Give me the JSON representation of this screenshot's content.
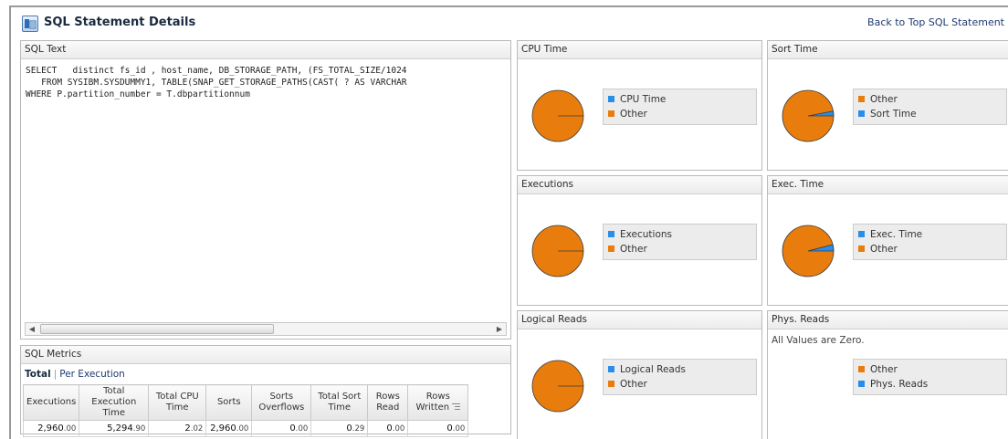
{
  "page": {
    "title": "SQL Statement Details",
    "back_link": "Back to Top SQL Statement"
  },
  "sql_text": {
    "header": "SQL Text",
    "lines": [
      "SELECT   distinct fs_id , host_name, DB_STORAGE_PATH, (FS_TOTAL_SIZE/1024",
      "   FROM SYSIBM.SYSDUMMY1, TABLE(SNAP_GET_STORAGE_PATHS(CAST( ? AS VARCHAR",
      "WHERE P.partition_number = T.dbpartitionnum"
    ]
  },
  "metrics": {
    "header": "SQL Metrics",
    "tab_active": "Total",
    "tab_separator": "|",
    "tab_other": "Per Execution",
    "columns": [
      "Executions",
      "Total Execution Time",
      "Total CPU Time",
      "Sorts",
      "Sorts Overflows",
      "Total Sort Time",
      "Rows Read",
      "Rows Written"
    ],
    "row": [
      {
        "int": "2,960",
        "dec": ".00"
      },
      {
        "int": "5,294",
        "dec": ".90"
      },
      {
        "int": "2",
        "dec": ".02"
      },
      {
        "int": "2,960",
        "dec": ".00"
      },
      {
        "int": "0",
        "dec": ".00"
      },
      {
        "int": "0",
        "dec": ".29"
      },
      {
        "int": "0",
        "dec": ".00"
      },
      {
        "int": "0",
        "dec": ".00"
      }
    ]
  },
  "colors": {
    "other": "#e87d0d",
    "metric": "#2a8ee8",
    "pie_stroke": "#3a3a3a"
  },
  "charts": {
    "cpu_time": {
      "header": "CPU Time",
      "legend": [
        {
          "label": "CPU Time",
          "color": "#2a8ee8"
        },
        {
          "label": "Other",
          "color": "#e87d0d"
        }
      ]
    },
    "sort_time": {
      "header": "Sort Time",
      "legend": [
        {
          "label": "Other",
          "color": "#e87d0d"
        },
        {
          "label": "Sort Time",
          "color": "#2a8ee8"
        }
      ]
    },
    "executions": {
      "header": "Executions",
      "legend": [
        {
          "label": "Executions",
          "color": "#2a8ee8"
        },
        {
          "label": "Other",
          "color": "#e87d0d"
        }
      ]
    },
    "exec_time": {
      "header": "Exec. Time",
      "legend": [
        {
          "label": "Exec. Time",
          "color": "#2a8ee8"
        },
        {
          "label": "Other",
          "color": "#e87d0d"
        }
      ]
    },
    "logical_reads": {
      "header": "Logical Reads",
      "legend": [
        {
          "label": "Logical Reads",
          "color": "#2a8ee8"
        },
        {
          "label": "Other",
          "color": "#e87d0d"
        }
      ]
    },
    "phys_reads": {
      "header": "Phys. Reads",
      "zero_message": "All Values are Zero.",
      "legend": [
        {
          "label": "Other",
          "color": "#e87d0d"
        },
        {
          "label": "Phys. Reads",
          "color": "#2a8ee8"
        }
      ]
    }
  },
  "chart_data": [
    {
      "type": "pie",
      "chart": "cpu_time",
      "labels": [
        "CPU Time",
        "Other"
      ],
      "values": [
        0.0,
        100.0
      ]
    },
    {
      "type": "pie",
      "chart": "sort_time",
      "labels": [
        "Sort Time",
        "Other"
      ],
      "values": [
        3.0,
        97.0
      ]
    },
    {
      "type": "pie",
      "chart": "executions",
      "labels": [
        "Executions",
        "Other"
      ],
      "values": [
        0.0,
        100.0
      ]
    },
    {
      "type": "pie",
      "chart": "exec_time",
      "labels": [
        "Exec. Time",
        "Other"
      ],
      "values": [
        4.0,
        96.0
      ]
    },
    {
      "type": "pie",
      "chart": "logical_reads",
      "labels": [
        "Logical Reads",
        "Other"
      ],
      "values": [
        0.0,
        100.0
      ]
    }
  ]
}
